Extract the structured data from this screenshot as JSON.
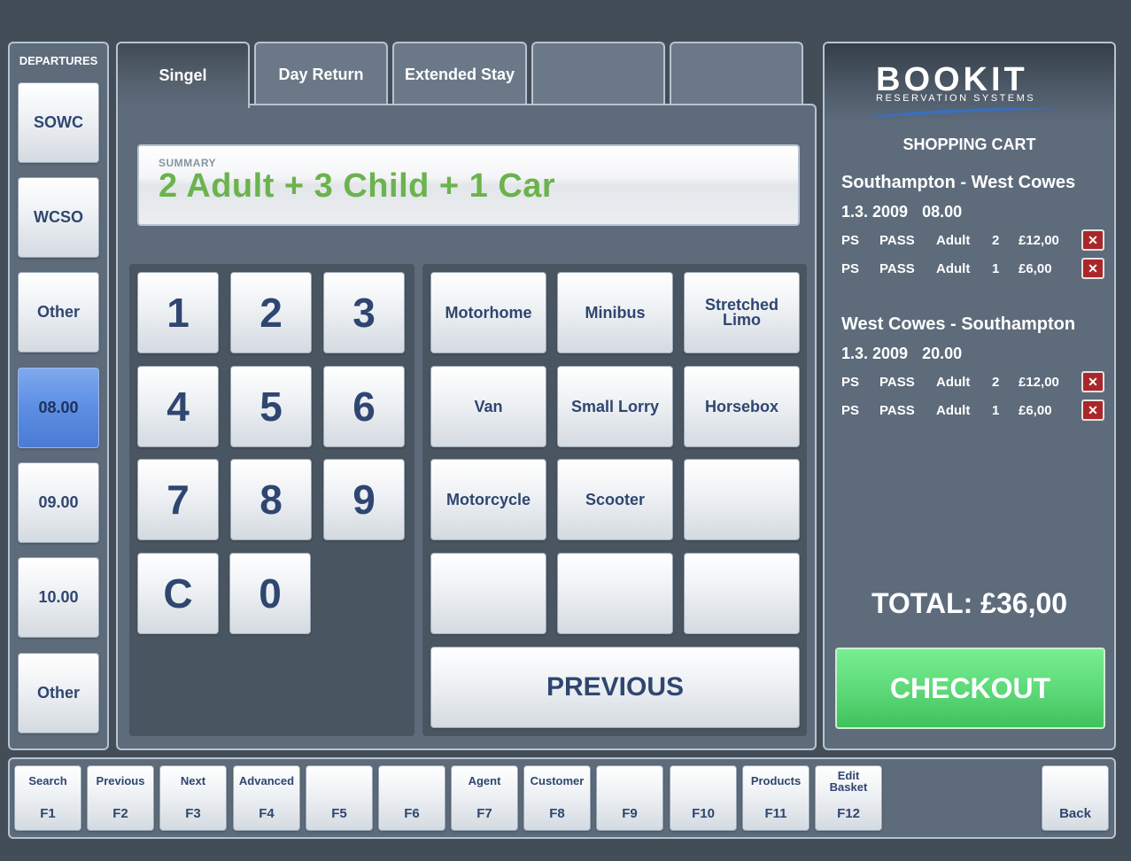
{
  "departures": {
    "title": "DEPARTURES",
    "items": [
      "SOWC",
      "WCSO",
      "Other",
      "08.00",
      "09.00",
      "10.00",
      "Other"
    ],
    "selected_index": 3
  },
  "tabs": [
    "Singel",
    "Day Return",
    "Extended Stay",
    "",
    ""
  ],
  "active_tab": 0,
  "summary": {
    "label": "SUMMARY",
    "text": "2 Adult + 3 Child + 1 Car"
  },
  "numpad": [
    "1",
    "2",
    "3",
    "4",
    "5",
    "6",
    "7",
    "8",
    "9",
    "C",
    "0"
  ],
  "vehicles": [
    "Motorhome",
    "Minibus",
    "Stretched Limo",
    "Van",
    "Small Lorry",
    "Horsebox",
    "Motorcycle",
    "Scooter",
    "",
    "",
    "",
    ""
  ],
  "previous_label": "PREVIOUS",
  "cart": {
    "logo_main": "BOOKIT",
    "logo_sub": "RESERVATION SYSTEMS",
    "title": "SHOPPING CART",
    "trips": [
      {
        "route": "Southampton - West Cowes",
        "date": "1.3. 2009",
        "time": "08.00",
        "lines": [
          {
            "c1": "PS",
            "c2": "PASS",
            "c3": "Adult",
            "qty": "2",
            "price": "£12,00"
          },
          {
            "c1": "PS",
            "c2": "PASS",
            "c3": "Adult",
            "qty": "1",
            "price": "£6,00"
          }
        ]
      },
      {
        "route": "West Cowes - Southampton",
        "date": "1.3. 2009",
        "time": "20.00",
        "lines": [
          {
            "c1": "PS",
            "c2": "PASS",
            "c3": "Adult",
            "qty": "2",
            "price": "£12,00"
          },
          {
            "c1": "PS",
            "c2": "PASS",
            "c3": "Adult",
            "qty": "1",
            "price": "£6,00"
          }
        ]
      }
    ],
    "delete_glyph": "✕",
    "total": "TOTAL: £36,00",
    "checkout_label": "CHECKOUT"
  },
  "function_keys": [
    {
      "label": "Search",
      "key": "F1"
    },
    {
      "label": "Previous",
      "key": "F2"
    },
    {
      "label": "Next",
      "key": "F3"
    },
    {
      "label": "Advanced",
      "key": "F4"
    },
    {
      "label": "",
      "key": "F5"
    },
    {
      "label": "",
      "key": "F6"
    },
    {
      "label": "Agent",
      "key": "F7"
    },
    {
      "label": "Customer",
      "key": "F8"
    },
    {
      "label": "",
      "key": "F9"
    },
    {
      "label": "",
      "key": "F10"
    },
    {
      "label": "Products",
      "key": "F11"
    },
    {
      "label": "Edit Basket",
      "key": "F12"
    },
    {
      "label": "",
      "key": "Back"
    }
  ],
  "colors": {
    "accent_selected": "#5c8ee4",
    "summary_text": "#6bb34d",
    "checkout_green": "#5fda7a",
    "delete_red": "#a9272a"
  }
}
